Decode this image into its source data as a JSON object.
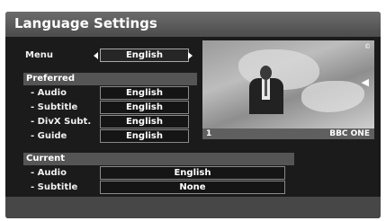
{
  "window": {
    "title": "Language Settings"
  },
  "menu": {
    "label": "Menu",
    "value": "English"
  },
  "preferred": {
    "header": "Preferred",
    "rows": [
      {
        "label": "- Audio",
        "value": "English"
      },
      {
        "label": "- Subtitle",
        "value": "English"
      },
      {
        "label": "- DivX Subt.",
        "value": "English"
      },
      {
        "label": "- Guide",
        "value": "English"
      }
    ]
  },
  "current": {
    "header": "Current",
    "rows": [
      {
        "label": "- Audio",
        "value": "English"
      },
      {
        "label": "- Subtitle",
        "value": "None"
      }
    ]
  },
  "preview": {
    "channel_number": "1",
    "channel_name": "BBC ONE",
    "corner_mark": "©"
  },
  "icons": {
    "menu_left": "arrow-left-icon",
    "menu_right": "arrow-right-icon",
    "audio": "speaker-icon"
  }
}
